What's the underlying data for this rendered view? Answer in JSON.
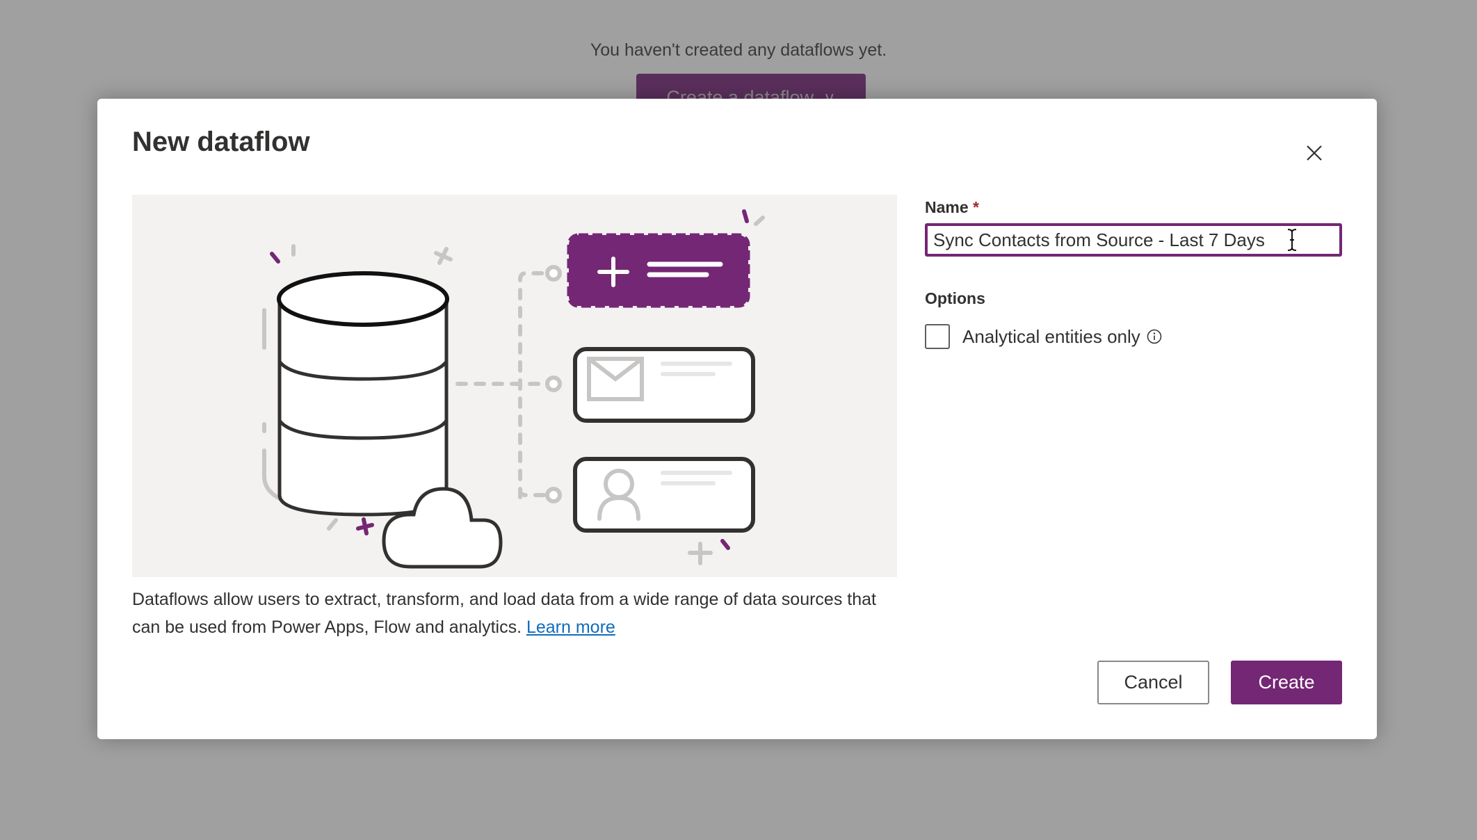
{
  "background": {
    "empty_message": "You haven't created any dataflows yet.",
    "create_button_label": "Create a dataflow",
    "create_button_icon": "chevron-down-icon"
  },
  "dialog": {
    "title": "New dataflow",
    "close_icon": "close-icon",
    "illustration": {
      "description": "Database with cloud connected by dashed lines to three cards: add (purple), email, contact",
      "cards": [
        "add-card",
        "email-card",
        "contact-card"
      ]
    },
    "description_text": "Dataflows allow users to extract, transform, and load data from a wide range of data sources that can be used from Power Apps, Flow and analytics.",
    "learn_more_label": "Learn more",
    "name_field": {
      "label": "Name",
      "required_marker": "*",
      "value": "Sync Contacts from Source - Last 7 Days"
    },
    "options": {
      "heading": "Options",
      "analytical_only": {
        "label": "Analytical entities only",
        "checked": false,
        "info_icon": "info-icon"
      }
    },
    "buttons": {
      "cancel_label": "Cancel",
      "create_label": "Create"
    }
  },
  "colors": {
    "brand": "#742774",
    "link": "#0f6cbd",
    "required": "#a4262c",
    "overlay": "#a0a0a0"
  }
}
